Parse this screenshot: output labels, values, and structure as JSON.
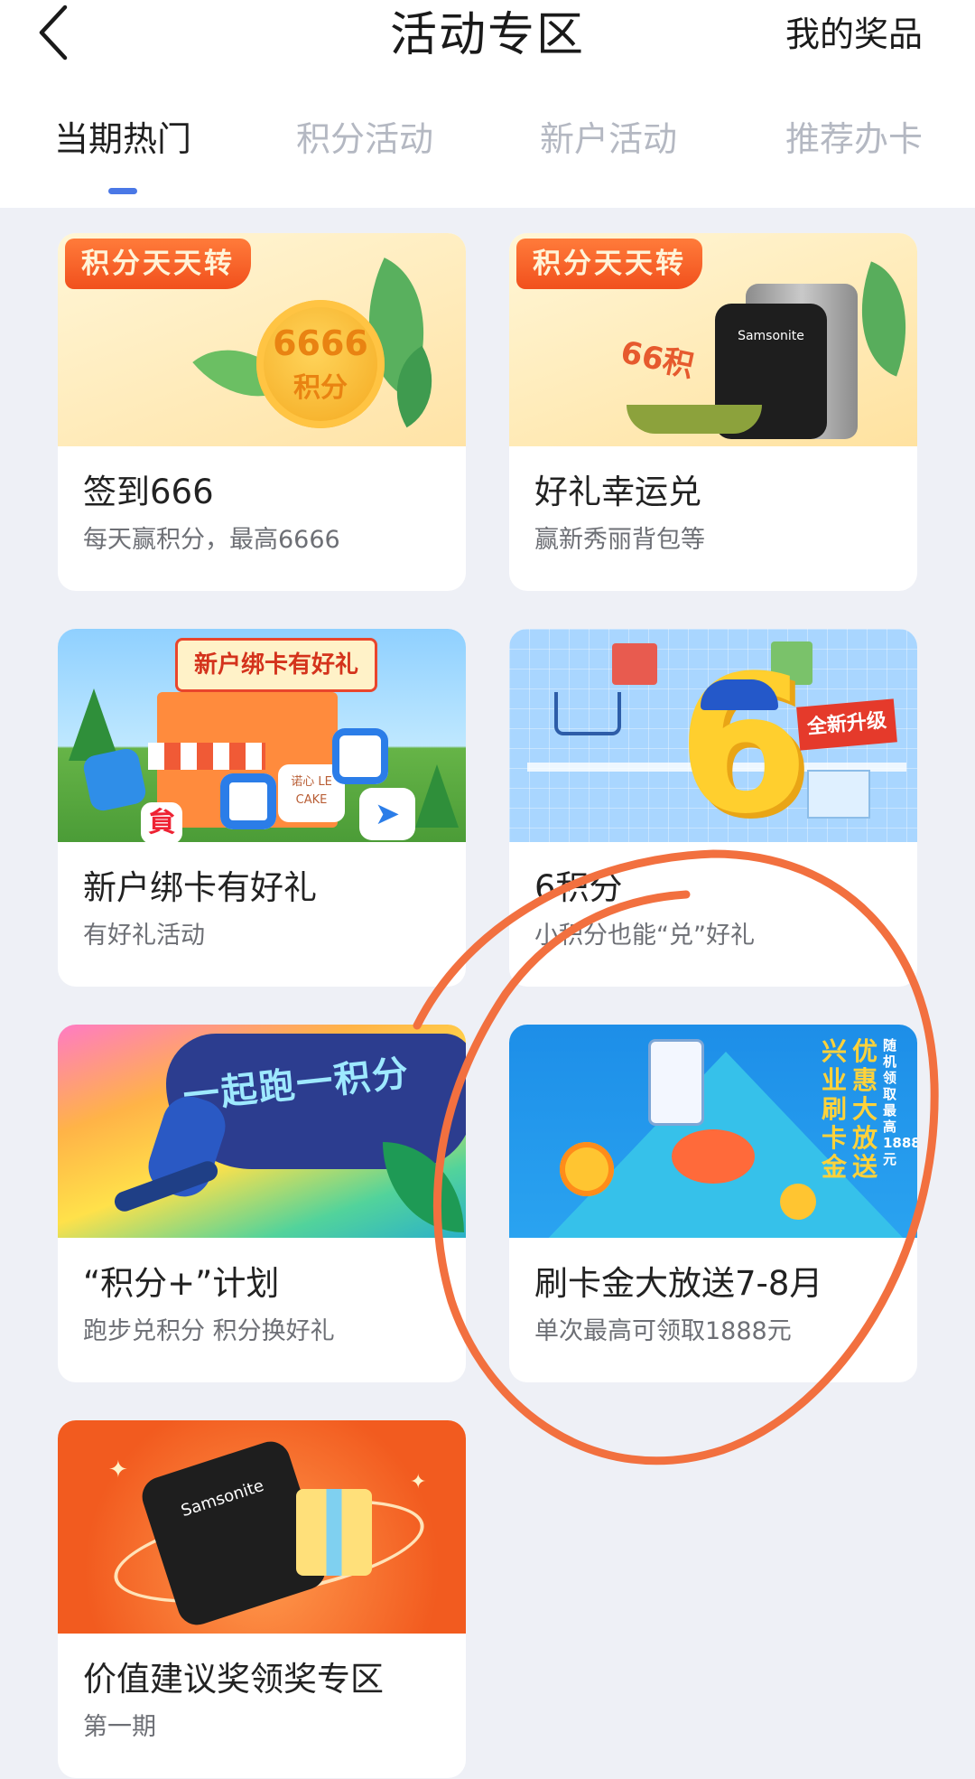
{
  "header": {
    "title": "活动专区",
    "right_link": "我的奖品"
  },
  "tabs": [
    {
      "label": "当期热门",
      "active": true
    },
    {
      "label": "积分活动",
      "active": false
    },
    {
      "label": "新户活动",
      "active": false
    },
    {
      "label": "推荐办卡",
      "active": false
    }
  ],
  "cards": [
    {
      "title": "签到666",
      "subtitle": "每天赢积分，最高6666",
      "banner": {
        "tag": "积分天天转",
        "coin_number": "6666",
        "coin_unit": "积分"
      }
    },
    {
      "title": "好礼幸运兑",
      "subtitle": "赢新秀丽背包等",
      "banner": {
        "tag": "积分天天转",
        "brand": "Samsonite",
        "ribbon": "66积"
      }
    },
    {
      "title": "新户绑卡有好礼",
      "subtitle": "有好礼活动",
      "banner": {
        "tag": "新户绑卡有好礼",
        "logo_text": "诺心 LE CAKE"
      }
    },
    {
      "title": "6积分",
      "subtitle": "小积分也能“兑”好礼",
      "banner": {
        "tag": "全新升级",
        "big_number": "6"
      }
    },
    {
      "title": "“积分+”计划",
      "subtitle": "跑步兑积分 积分换好礼",
      "banner": {
        "art_text": "一起跑一积分"
      }
    },
    {
      "title": "刷卡金大放送7-8月",
      "subtitle": "单次最高可领取1888元",
      "banner": {
        "v1": "兴业刷卡金",
        "v2": "优惠大放送",
        "v3": "随机领取最高1888元"
      }
    },
    {
      "title": "价值建议奖领奖专区",
      "subtitle": "第一期",
      "banner": {
        "brand": "Samsonite"
      }
    }
  ],
  "colors": {
    "accent": "#4a78e6",
    "annotation": "#f2703f",
    "tag_orange": "#f1501d",
    "page_bg": "#eef0f6"
  }
}
